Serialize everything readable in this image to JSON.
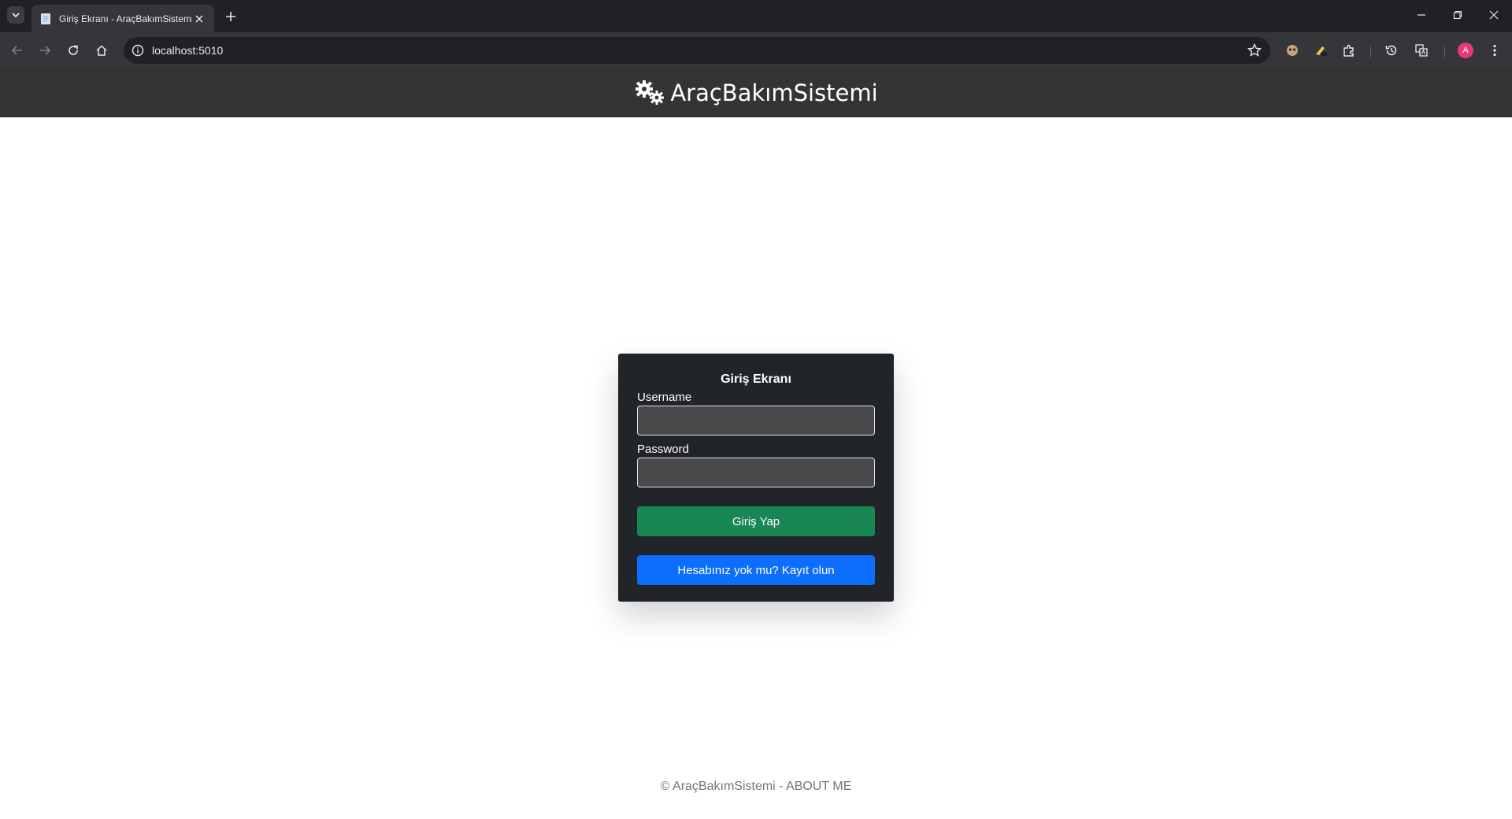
{
  "browser": {
    "tab_title": "Giriş Ekranı - AraçBakımSistemi",
    "url": "localhost:5010",
    "profile_initial": "A",
    "profile_color": "#e8387e"
  },
  "app": {
    "brand": "AraçBakımSistemi"
  },
  "login": {
    "title": "Giriş Ekranı",
    "username_label": "Username",
    "username_value": "",
    "password_label": "Password",
    "password_value": "",
    "login_button": "Giriş Yap",
    "register_button": "Hesabınız yok mu? Kayıt olun"
  },
  "footer": {
    "text": "© AraçBakımSistemi - ABOUT ME"
  },
  "colors": {
    "header_bg": "#343434",
    "card_bg": "#212529",
    "login_button": "#198754",
    "register_button": "#0d6efd"
  },
  "icons": [
    "tab-search-icon",
    "page-favicon-icon",
    "close-icon",
    "plus-icon",
    "minimize-icon",
    "restore-icon",
    "window-close-icon",
    "back-arrow-icon",
    "forward-arrow-icon",
    "reload-icon",
    "home-icon",
    "site-info-icon",
    "bookmark-star-icon",
    "extension-icon",
    "puzzle-icon",
    "history-icon",
    "translate-icon",
    "menu-dots-icon",
    "gears-icon"
  ]
}
